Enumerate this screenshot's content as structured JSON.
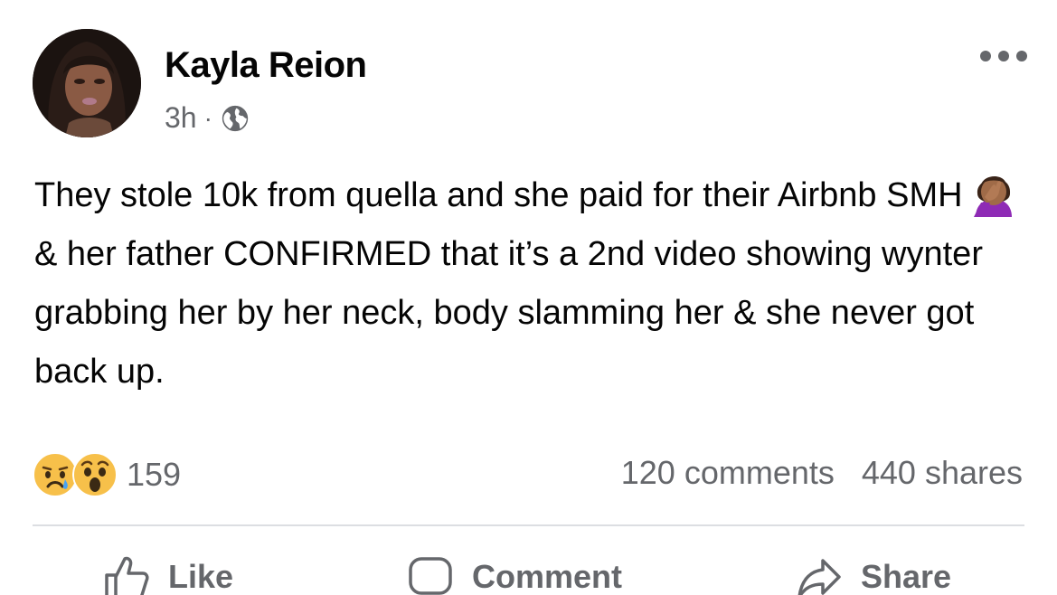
{
  "post": {
    "author": "Kayla Reion",
    "time": "3h",
    "separator": "·",
    "privacy_icon": "globe-icon",
    "text_part1": "They stole 10k from quella and she paid for their Airbnb SMH",
    "inline_emoji": "facepalm-emoji",
    "text_part2": "& her father CONFIRMED that it’s a 2nd video showing wynter grabbing her by her neck, body slamming her & she never got back up."
  },
  "reactions": {
    "icons": [
      "sad-reaction-icon",
      "wow-reaction-icon"
    ],
    "count": "159"
  },
  "stats": {
    "comments": "120 comments",
    "shares": "440 shares"
  },
  "actions": {
    "like": "Like",
    "comment": "Comment",
    "share": "Share"
  },
  "colors": {
    "text": "#050505",
    "secondary": "#65676b",
    "divider": "#dcdee2"
  }
}
